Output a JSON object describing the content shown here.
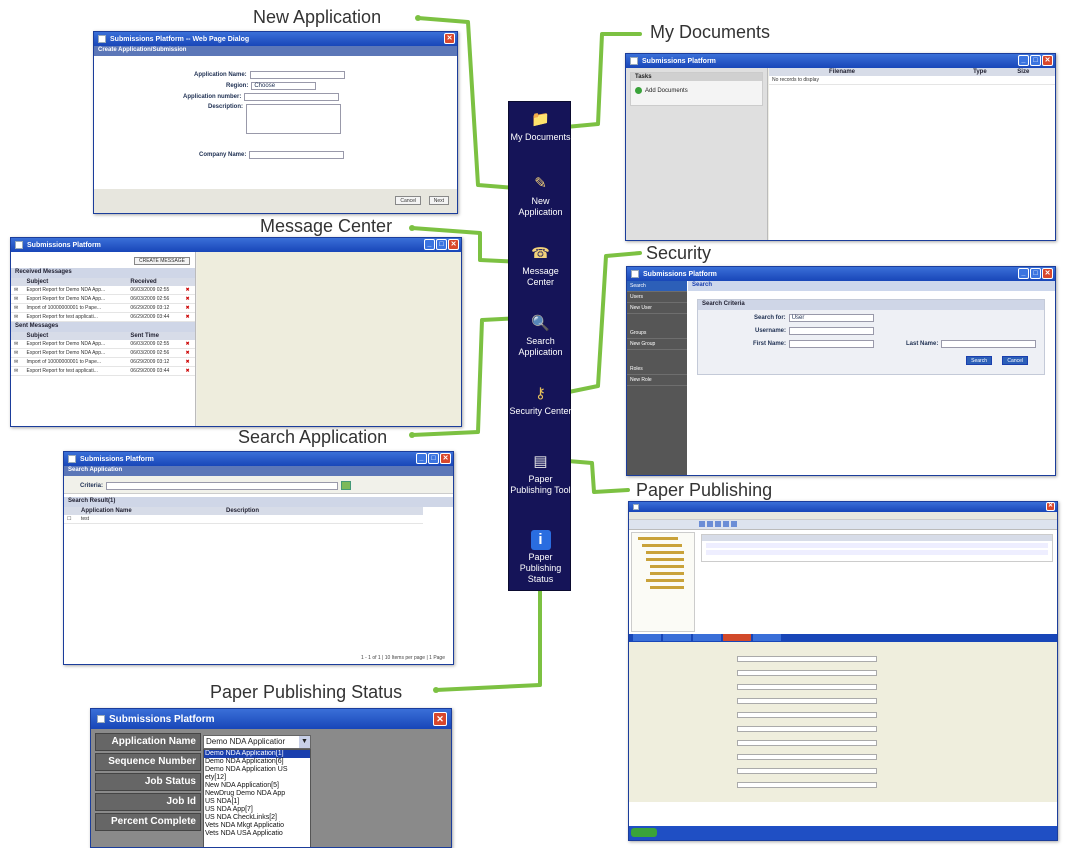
{
  "callouts": {
    "new_application": "New Application",
    "my_documents": "My Documents",
    "message_center": "Message Center",
    "security": "Security",
    "search_application": "Search Application",
    "paper_publishing": "Paper Publishing",
    "paper_publishing_status": "Paper Publishing Status"
  },
  "toolbar": {
    "items": [
      {
        "label": "My Documents",
        "icon": "documents-icon"
      },
      {
        "label": "New Application",
        "icon": "new-application-icon"
      },
      {
        "label": "Message Center",
        "icon": "message-center-icon"
      },
      {
        "label": "Search Application",
        "icon": "search-application-icon"
      },
      {
        "label": "Security Center",
        "icon": "key-icon"
      },
      {
        "label": "Paper Publishing Tool",
        "icon": "publishing-icon"
      },
      {
        "label": "Paper Publishing Status",
        "icon": "info-icon"
      }
    ]
  },
  "colors": {
    "toolbar_bg": "#151458",
    "titlebar": "#1846b8",
    "connector": "#7cc142",
    "close_btn": "#d8472c"
  },
  "new_app": {
    "title": "Submissions Platform -- Web Page Dialog",
    "subtitle": "Create Application/Submission",
    "fields": [
      "Application Name:",
      "Region:",
      "Application number:",
      "Description:",
      "Company Name:"
    ],
    "region_value": "Choose",
    "cancel": "Cancel",
    "next": "Next"
  },
  "my_docs": {
    "title": "Submissions Platform",
    "tasks_header": "Tasks",
    "task_item": "Add Documents",
    "columns": [
      "Filename",
      "Type",
      "Size"
    ],
    "empty": "No records to display"
  },
  "message_center": {
    "title": "Submissions Platform",
    "create_button": "CREATE MESSAGE",
    "received_header": "Received Messages",
    "received_columns": [
      "Subject",
      "Received"
    ],
    "received": [
      {
        "subject": "Export Report for Demo NDA App...",
        "date": "06/03/2009 02:55"
      },
      {
        "subject": "Export Report for Demo NDA App...",
        "date": "06/03/2009 02:56"
      },
      {
        "subject": "Import of 10000000001 to Pape...",
        "date": "06/29/2009 03:12"
      },
      {
        "subject": "Export Report for test applicati...",
        "date": "06/29/2009 03:44"
      }
    ],
    "sent_header": "Sent Messages",
    "sent_columns": [
      "Subject",
      "Sent Time"
    ],
    "sent": [
      {
        "subject": "Export Report for Demo NDA App...",
        "date": "06/03/2009 02:55"
      },
      {
        "subject": "Export Report for Demo NDA App...",
        "date": "06/03/2009 02:56"
      },
      {
        "subject": "Import of 10000000001 to Pape...",
        "date": "06/29/2009 03:12"
      },
      {
        "subject": "Export Report for test applicati...",
        "date": "06/29/2009 03:44"
      }
    ]
  },
  "security": {
    "title": "Submissions Platform",
    "side_items": [
      "Search",
      "Users",
      "New User",
      "Groups",
      "New Group",
      "Roles",
      "New Role"
    ],
    "tab": "Search",
    "criteria_header": "Search Criteria",
    "search_for_label": "Search for:",
    "search_for_value": "User",
    "username_label": "Username:",
    "first_name_label": "First Name:",
    "last_name_label": "Last Name:",
    "search_btn": "Search",
    "cancel_btn": "Cancel"
  },
  "search_app": {
    "title": "Submissions Platform",
    "subtitle": "Search Application",
    "criteria_label": "Criteria:",
    "results_header": "Search Result(1)",
    "columns": [
      "Application Name",
      "Description"
    ],
    "row": "test",
    "pager": "1 - 1 of 1 | 10 Items per page | 1 Page"
  },
  "pps": {
    "title": "Submissions Platform",
    "labels": [
      "Application Name",
      "Sequence Number",
      "Job Status",
      "Job Id",
      "Percent Complete"
    ],
    "selected_value": "Demo NDA Applicatior",
    "options": [
      "Demo NDA Application[1]",
      "Demo NDA Application[6]",
      "Demo NDA Application US",
      "ety[12]",
      "New NDA Application[5]",
      "NewDrug Demo NDA App",
      "US NDA[1]",
      "US NDA App[7]",
      "US NDA CheckLinks[2]",
      "Vets NDA Mkgt Applicatio",
      "Vets NDA USA Applicatio"
    ]
  }
}
